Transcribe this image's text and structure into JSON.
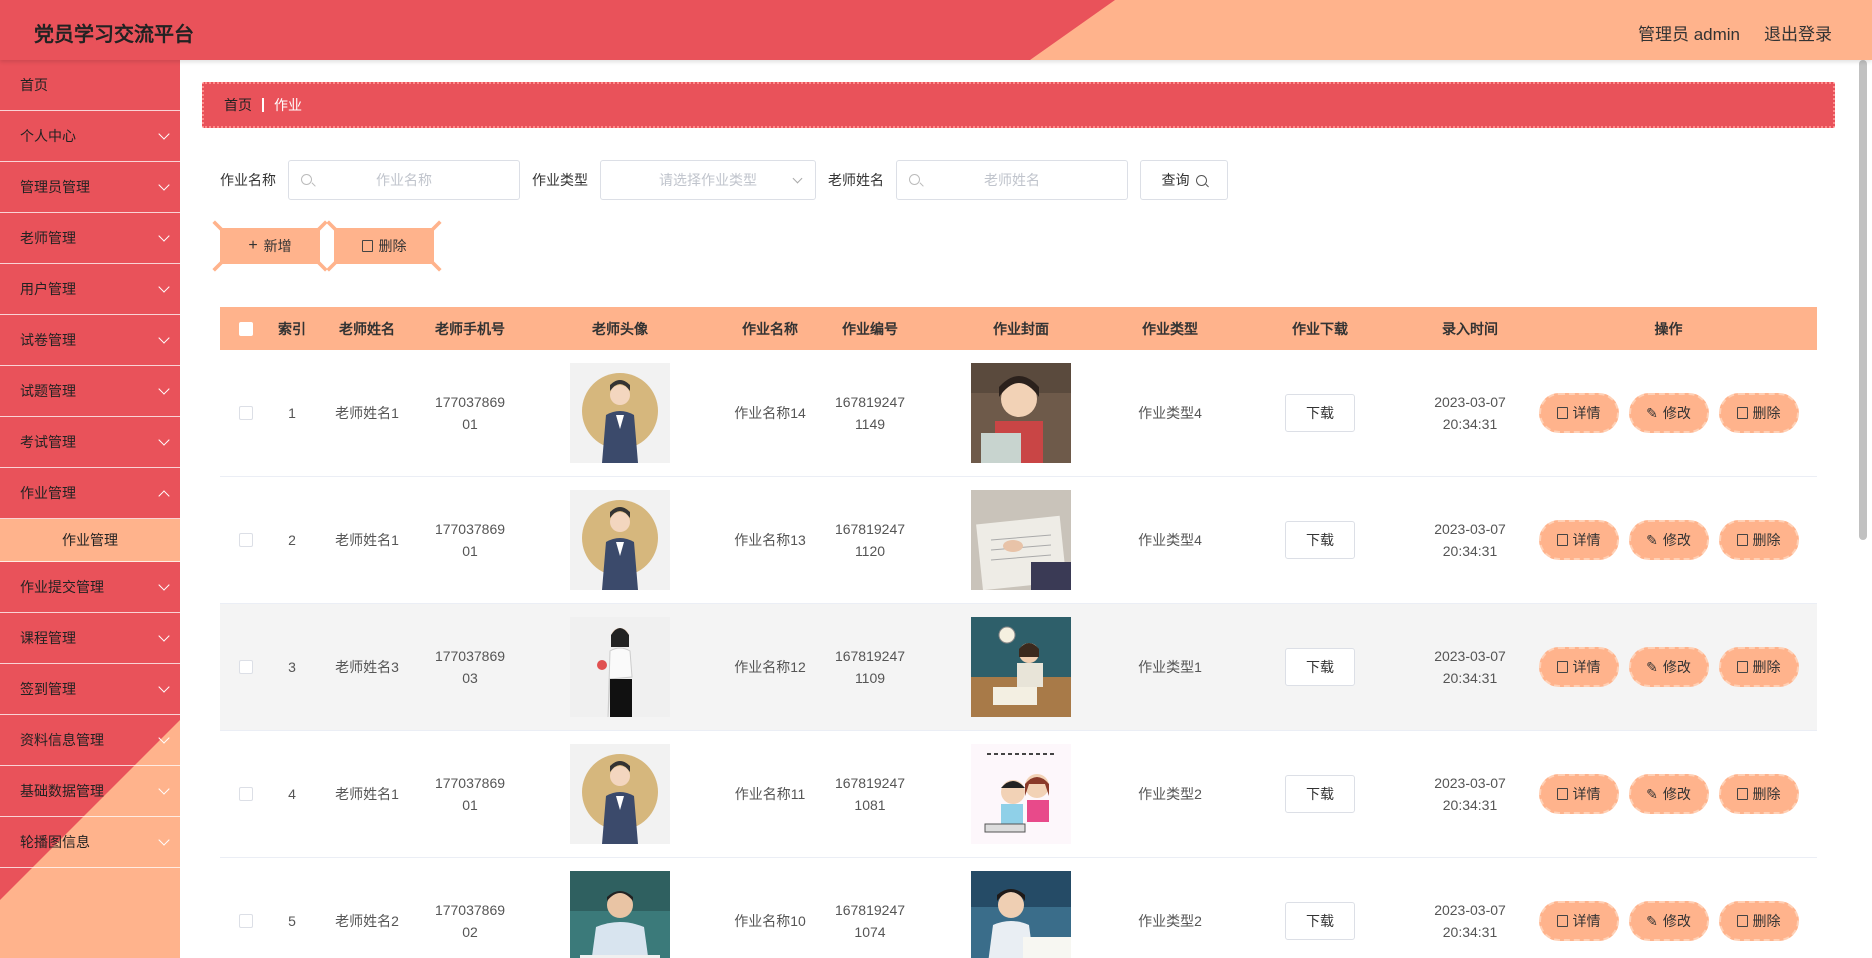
{
  "header": {
    "title": "党员学习交流平台",
    "user": "管理员 admin",
    "logout": "退出登录"
  },
  "sidebar": {
    "items": [
      {
        "label": "首页"
      },
      {
        "label": "个人中心"
      },
      {
        "label": "管理员管理"
      },
      {
        "label": "老师管理"
      },
      {
        "label": "用户管理"
      },
      {
        "label": "试卷管理"
      },
      {
        "label": "试题管理"
      },
      {
        "label": "考试管理"
      },
      {
        "label": "作业管理"
      },
      {
        "label": "作业提交管理"
      },
      {
        "label": "课程管理"
      },
      {
        "label": "签到管理"
      },
      {
        "label": "资料信息管理"
      },
      {
        "label": "基础数据管理"
      },
      {
        "label": "轮播图信息"
      }
    ],
    "sub_item": "作业管理"
  },
  "breadcrumb": {
    "home": "首页",
    "current": "作业"
  },
  "search": {
    "name_label": "作业名称",
    "name_placeholder": "作业名称",
    "type_label": "作业类型",
    "type_placeholder": "请选择作业类型",
    "teacher_label": "老师姓名",
    "teacher_placeholder": "老师姓名",
    "query": "查询"
  },
  "actions": {
    "add": "新增",
    "delete": "删除"
  },
  "table": {
    "headers": [
      "索引",
      "老师姓名",
      "老师手机号",
      "老师头像",
      "作业名称",
      "作业编号",
      "作业封面",
      "作业类型",
      "作业下载",
      "录入时间",
      "操作"
    ],
    "rows": [
      {
        "index": "1",
        "teacher": "老师姓名1",
        "phone1": "177037869",
        "phone2": "01",
        "name": "作业名称14",
        "num1": "167819247",
        "num2": "1149",
        "type": "作业类型4",
        "download": "下载",
        "date": "2023-03-07",
        "time": "20:34:31"
      },
      {
        "index": "2",
        "teacher": "老师姓名1",
        "phone1": "177037869",
        "phone2": "01",
        "name": "作业名称13",
        "num1": "167819247",
        "num2": "1120",
        "type": "作业类型4",
        "download": "下载",
        "date": "2023-03-07",
        "time": "20:34:31"
      },
      {
        "index": "3",
        "teacher": "老师姓名3",
        "phone1": "177037869",
        "phone2": "03",
        "name": "作业名称12",
        "num1": "167819247",
        "num2": "1109",
        "type": "作业类型1",
        "download": "下载",
        "date": "2023-03-07",
        "time": "20:34:31"
      },
      {
        "index": "4",
        "teacher": "老师姓名1",
        "phone1": "177037869",
        "phone2": "01",
        "name": "作业名称11",
        "num1": "167819247",
        "num2": "1081",
        "type": "作业类型2",
        "download": "下载",
        "date": "2023-03-07",
        "time": "20:34:31"
      },
      {
        "index": "5",
        "teacher": "老师姓名2",
        "phone1": "177037869",
        "phone2": "02",
        "name": "作业名称10",
        "num1": "167819247",
        "num2": "1074",
        "type": "作业类型2",
        "download": "下载",
        "date": "2023-03-07",
        "time": "20:34:31"
      }
    ],
    "ops": {
      "detail": "详情",
      "edit": "修改",
      "delete": "删除"
    }
  },
  "colors": {
    "primary_red": "#e9525a",
    "accent_peach": "#ffb38c"
  }
}
